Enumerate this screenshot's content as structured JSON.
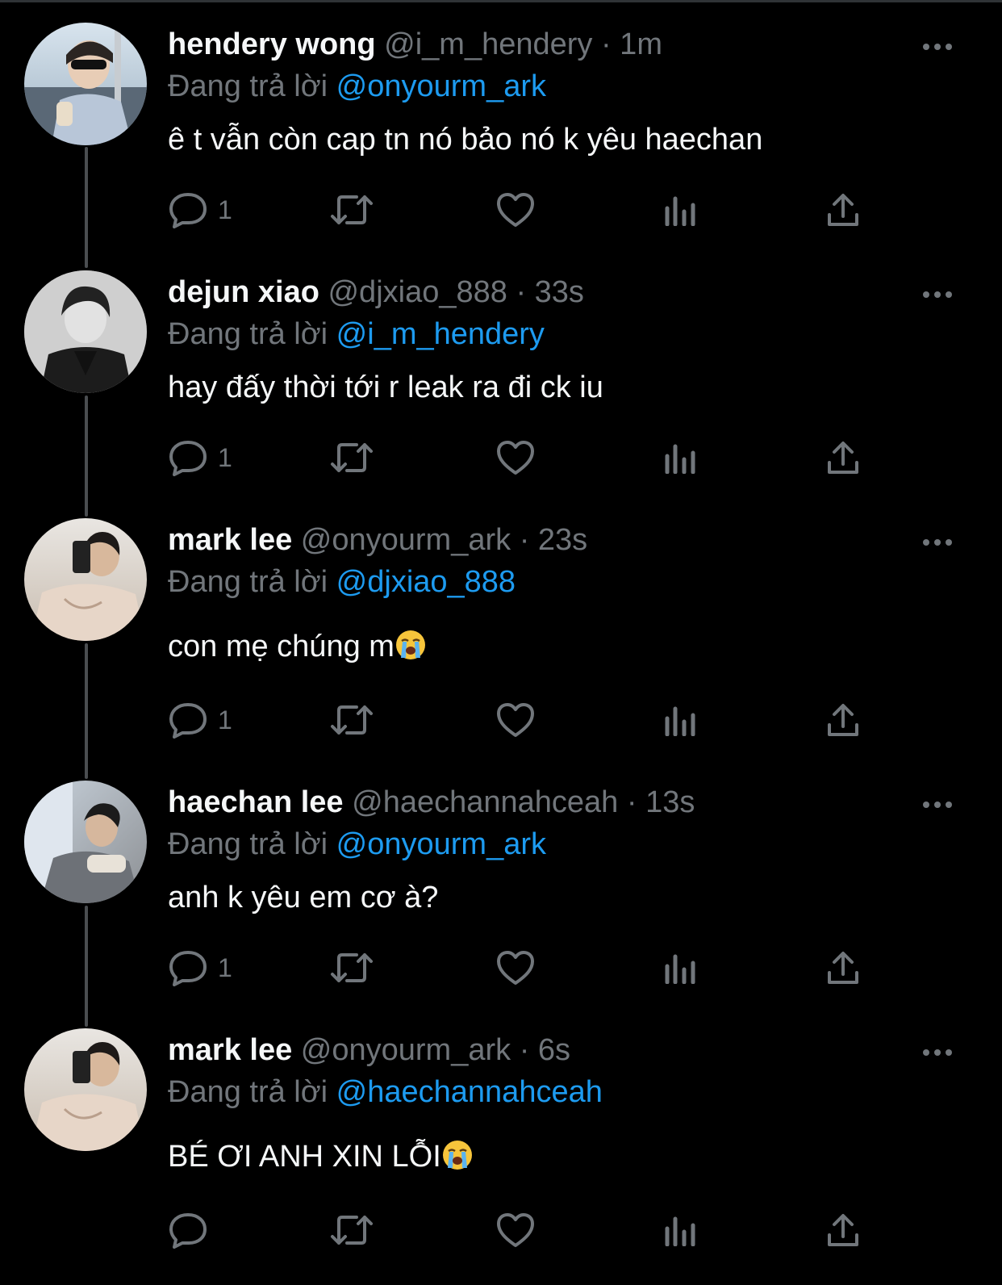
{
  "colors": {
    "background": "#000000",
    "primary_text": "#f5f7f8",
    "secondary_text": "#71767b",
    "mention": "#1d9bf0",
    "thread_line": "#4a4d50"
  },
  "reply_prefix": "Đang trả lời",
  "tweets": [
    {
      "name": "hendery wong",
      "handle": "@i_m_hendery",
      "time": "· 1m",
      "reply_to": "@onyourm_ark",
      "text": "ê t vẫn còn cap tn nó bảo nó k yêu haechan",
      "reply_count": "1",
      "avatar": "avatar-hendery"
    },
    {
      "name": "dejun xiao",
      "handle": "@djxiao_888",
      "time": "· 33s",
      "reply_to": "@i_m_hendery",
      "text": "hay đấy thời tới r leak ra đi ck iu",
      "reply_count": "1",
      "avatar": "avatar-dejun"
    },
    {
      "name": "mark lee",
      "handle": "@onyourm_ark",
      "time": "· 23s",
      "reply_to": "@djxiao_888",
      "text": "con mẹ chúng m",
      "emoji": "loudly-crying-face",
      "reply_count": "1",
      "avatar": "avatar-mark"
    },
    {
      "name": "haechan lee",
      "handle": "@haechannahceah",
      "time": "· 13s",
      "reply_to": "@onyourm_ark",
      "text": "anh k yêu em cơ à?",
      "reply_count": "1",
      "avatar": "avatar-haechan"
    },
    {
      "name": "mark lee",
      "handle": "@onyourm_ark",
      "time": "· 6s",
      "reply_to": "@haechannahceah",
      "text": "BÉ ƠI ANH XIN LỖI",
      "emoji": "loudly-crying-face",
      "reply_count": "",
      "avatar": "avatar-mark"
    }
  ],
  "icons": {
    "reply": "reply-icon",
    "retweet": "retweet-icon",
    "like": "heart-icon",
    "views": "views-icon",
    "share": "share-icon",
    "more": "more-icon"
  }
}
